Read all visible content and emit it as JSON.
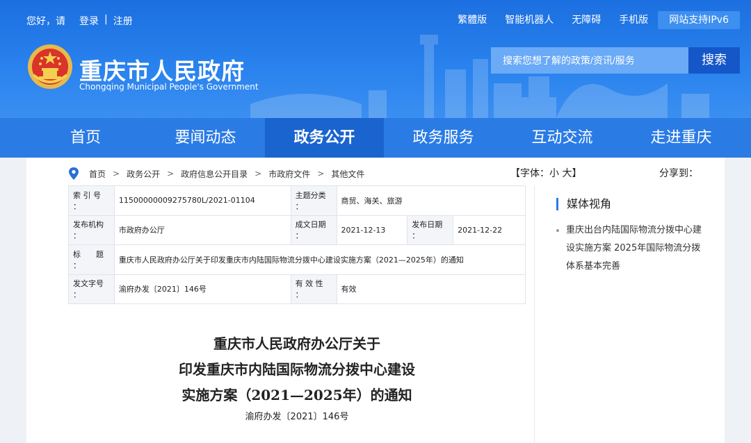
{
  "topbar": {
    "greeting": "您好，请",
    "login": "登录",
    "divider": "|",
    "register": "注册",
    "links": [
      "繁體版",
      "智能机器人",
      "无障碍",
      "手机版"
    ],
    "ipv6": "网站支持IPv6"
  },
  "site": {
    "title": "重庆市人民政府",
    "subtitle": "Chongqing Municipal People's Government"
  },
  "search": {
    "placeholder": "搜索您想了解的政策/资讯/服务",
    "button": "搜索"
  },
  "nav": {
    "items": [
      "首页",
      "要闻动态",
      "政务公开",
      "政务服务",
      "互动交流",
      "走进重庆"
    ],
    "active_index": 2
  },
  "breadcrumb": {
    "items": [
      "首页",
      "政务公开",
      "政府信息公开目录",
      "市政府文件",
      "其他文件"
    ],
    "separator": ">"
  },
  "font_size": {
    "label": "【字体：",
    "small": "小",
    "large": "大",
    "end": "】"
  },
  "share_label": "分享到：",
  "meta": {
    "index_label": "索 引 号 ：",
    "index_value": "11500000009275780L/2021-01104",
    "topic_label": "主题分类 ：",
    "topic_value": "商贸、海关、旅游",
    "issuer_label": "发布机构 ：",
    "issuer_value": "市政府办公厅",
    "created_label": "成文日期 ：",
    "created_value": "2021-12-13",
    "published_label": "发布日期 ：",
    "published_value": "2021-12-22",
    "title_label": "标　　题 ：",
    "title_value": "重庆市人民政府办公厅关于印发重庆市内陆国际物流分拨中心建设实施方案（2021—2025年）的通知",
    "docno_label": "发文字号 ：",
    "docno_value": "渝府办发〔2021〕146号",
    "validity_label": "有 效 性 ：",
    "validity_value": "有效"
  },
  "sidebar": {
    "title": "媒体视角",
    "items": [
      "重庆出台内陆国际物流分拨中心建设实施方案 2025年国际物流分拨体系基本完善"
    ]
  },
  "document": {
    "title_lines": [
      "重庆市人民政府办公厅关于",
      "印发重庆市内陆国际物流分拨中心建设",
      "实施方案（2021—2025年）的通知"
    ],
    "number": "渝府办发〔2021〕146号"
  },
  "colors": {
    "header_blue": "#2a83ee",
    "nav_blue": "#2b7be5",
    "nav_active": "#1a64cf",
    "search_button": "#1557c8"
  }
}
